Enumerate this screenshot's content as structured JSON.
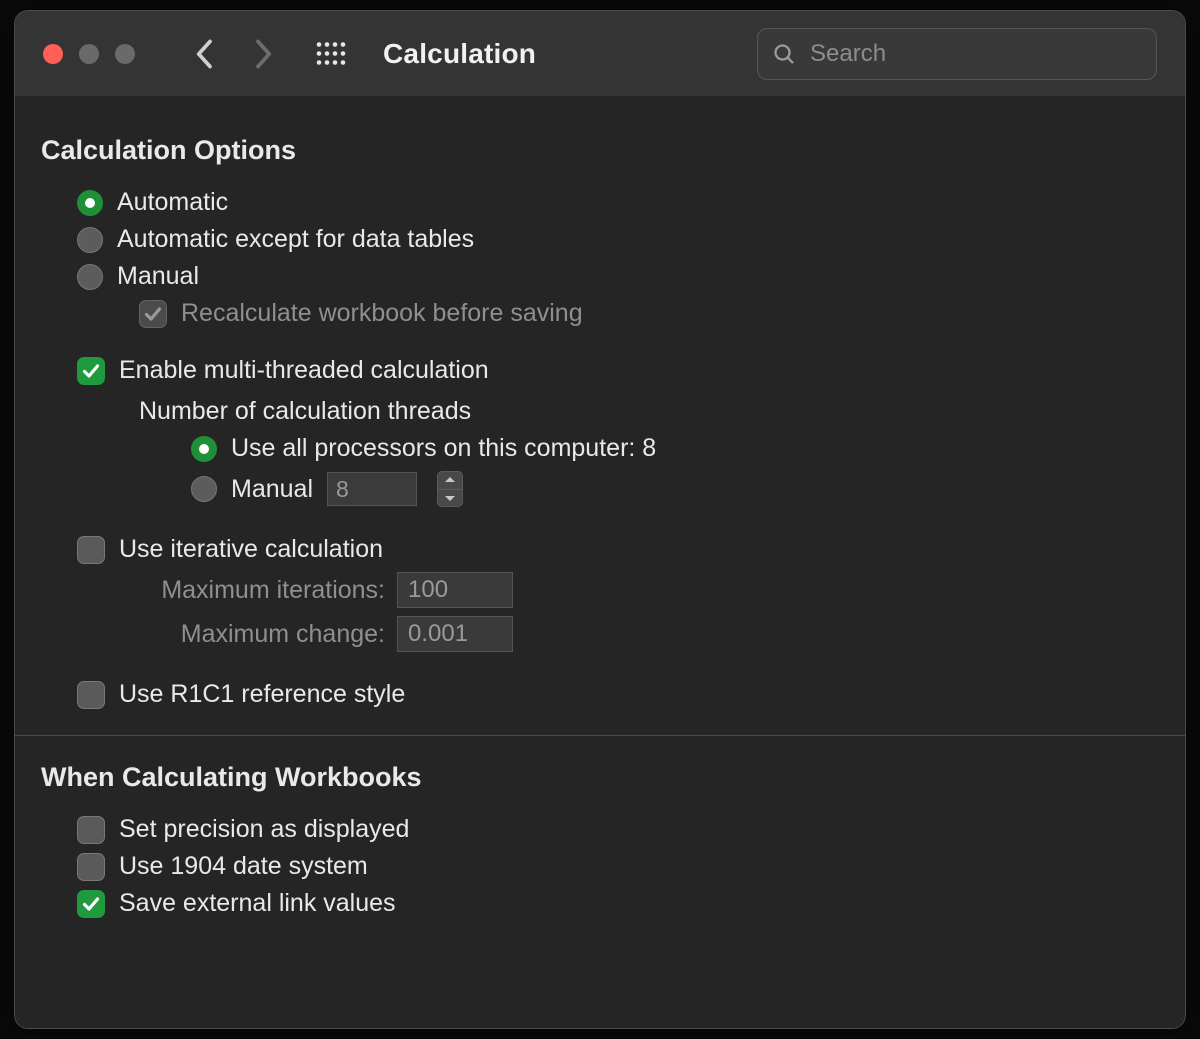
{
  "header": {
    "title": "Calculation",
    "search_placeholder": "Search"
  },
  "sections": {
    "calc_options": {
      "title": "Calculation Options",
      "radios": {
        "automatic": "Automatic",
        "auto_except": "Automatic except for data tables",
        "manual": "Manual"
      },
      "recalc_before_save": "Recalculate workbook before saving",
      "enable_multithread": "Enable multi-threaded calculation",
      "threads_label": "Number of calculation threads",
      "use_all_processors": "Use all processors on this computer: 8",
      "threads_manual": "Manual",
      "threads_manual_value": "8",
      "use_iterative": "Use iterative calculation",
      "max_iterations_label": "Maximum iterations:",
      "max_iterations_value": "100",
      "max_change_label": "Maximum change:",
      "max_change_value": "0.001",
      "r1c1": "Use R1C1 reference style"
    },
    "workbooks": {
      "title": "When Calculating Workbooks",
      "precision": "Set precision as displayed",
      "date1904": "Use 1904 date system",
      "save_external": "Save external link values"
    }
  }
}
